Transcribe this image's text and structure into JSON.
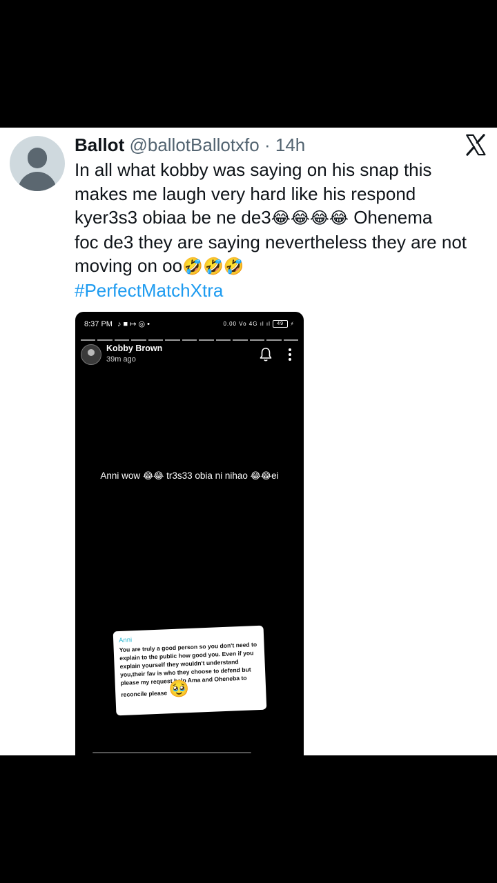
{
  "tweet": {
    "author_name": "Ballot",
    "handle": "@ballotBallotxfo",
    "separator": "·",
    "time": "14h",
    "lines": [
      "In all what kobby was saying on his snap this",
      "makes me laugh very hard like his respond",
      "kyer3s3 obiaa be ne de3",
      "Ohenema",
      "foc de3 they are saying nevertheless they are not",
      "moving on oo"
    ],
    "emoji_laugh_cry": "😂😂😂😂",
    "emoji_rofl": "🤣🤣🤣",
    "hashtag": "#PerfectMatchXtra",
    "icons": {
      "avatar": "default-avatar-icon",
      "brand": "x-logo-icon"
    }
  },
  "screenshot": {
    "status_time": "8:37 PM",
    "status_icons": "♪ ■ ↦ ◎ •",
    "status_right": "0.00 Vo 4G ıl ıl",
    "battery": "49",
    "snap_user": "Kobby Brown",
    "snap_time": "39m ago",
    "caption_a": "Anni wow ",
    "caption_emoji_a": "😂😂",
    "caption_b": " tr3s33 obia ni nihao ",
    "caption_emoji_b": "😂😂",
    "caption_c": "ei",
    "card_author": "Anni",
    "card_text": "You are truly a good person so you don't need to explain to the public how good you. Even if you explain yourself they wouldn't understand you,their fav is who they choose to defend but please my request help Ama and Oheneba to reconcile please",
    "card_emoji": "🥹"
  }
}
